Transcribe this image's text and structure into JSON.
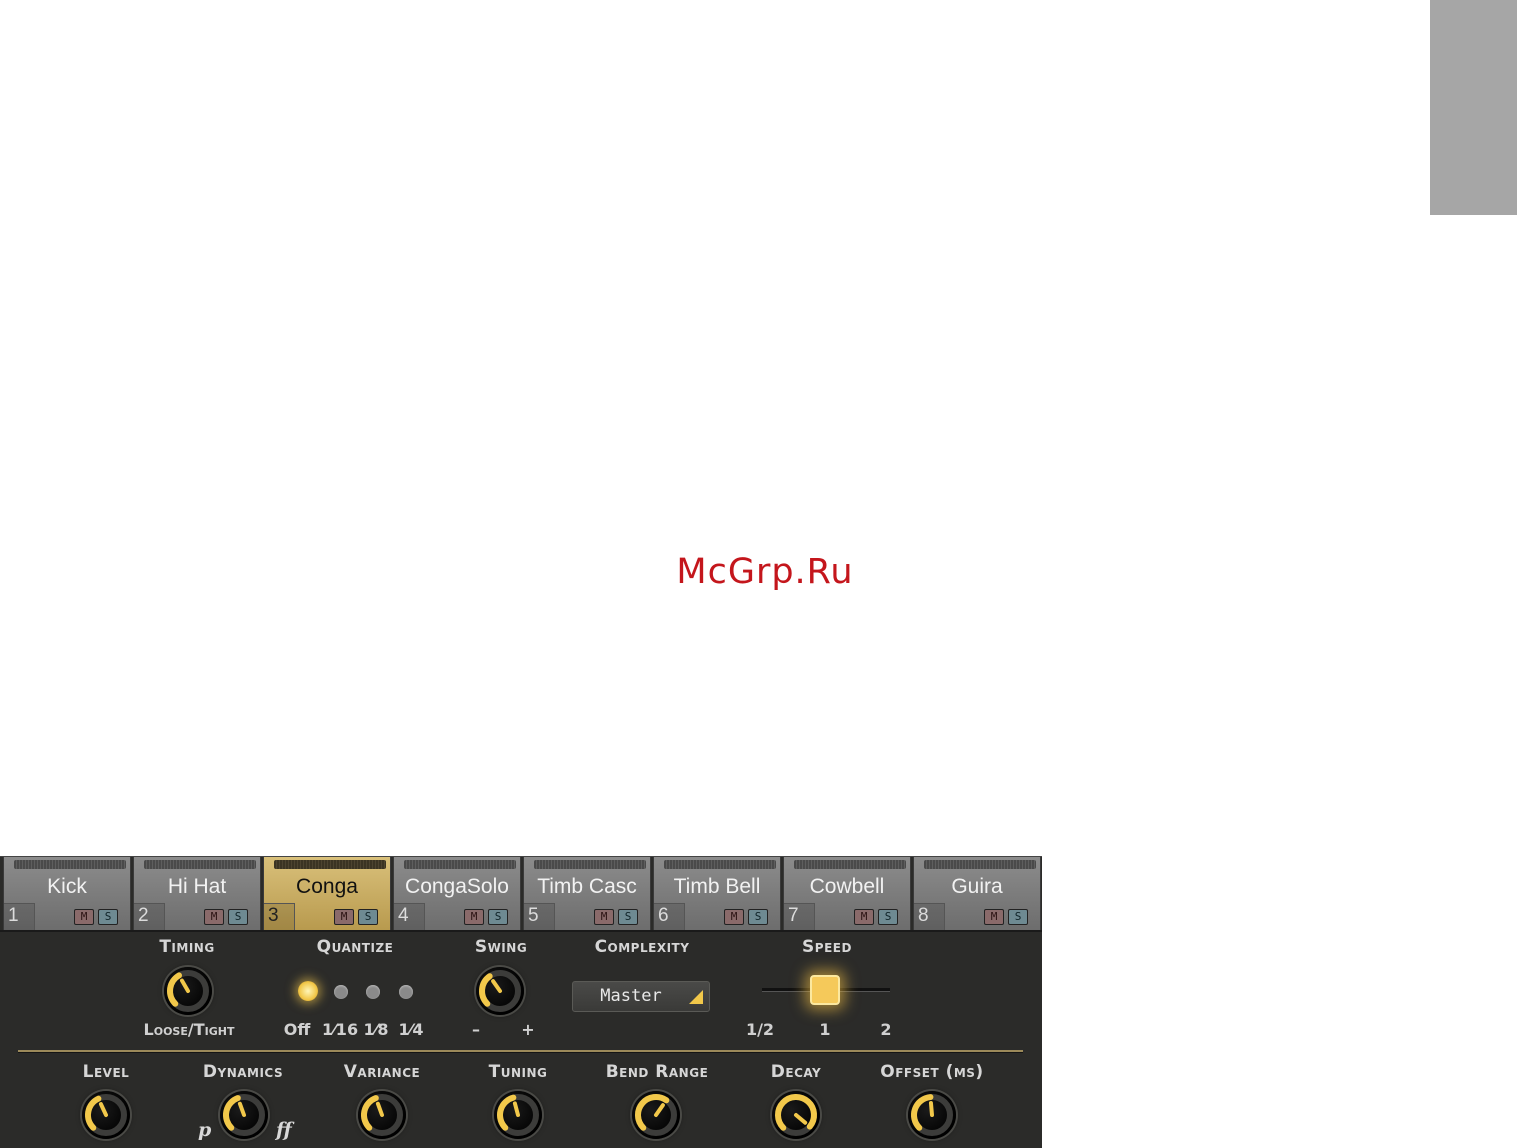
{
  "watermark": "McGrp.Ru",
  "tabs": [
    {
      "name": "Kick",
      "number": "1",
      "active": false
    },
    {
      "name": "Hi Hat",
      "number": "2",
      "active": false
    },
    {
      "name": "Conga",
      "number": "3",
      "active": true
    },
    {
      "name": "CongaSolo",
      "number": "4",
      "active": false
    },
    {
      "name": "Timb Casc",
      "number": "5",
      "active": false
    },
    {
      "name": "Timb Bell",
      "number": "6",
      "active": false
    },
    {
      "name": "Cowbell",
      "number": "7",
      "active": false
    },
    {
      "name": "Guira",
      "number": "8",
      "active": false
    }
  ],
  "mute_label": "M",
  "solo_label": "S",
  "timing": {
    "label": "Timing",
    "sublabel": "Loose/Tight"
  },
  "quantize": {
    "label": "Quantize",
    "options": [
      "Off",
      "1⁄16",
      "1⁄8",
      "1⁄4"
    ],
    "selected": "Off"
  },
  "swing": {
    "label": "Swing",
    "minus": "–",
    "plus": "+"
  },
  "complexity": {
    "label": "Complexity",
    "value": "Master"
  },
  "speed": {
    "label": "Speed",
    "ticks": [
      "1/2",
      "1",
      "2"
    ],
    "selected": "1"
  },
  "knobs": [
    {
      "label": "Level"
    },
    {
      "label": "Dynamics",
      "min_mark": "p",
      "max_mark": "ff"
    },
    {
      "label": "Variance"
    },
    {
      "label": "Tuning"
    },
    {
      "label": "Bend Range"
    },
    {
      "label": "Decay"
    },
    {
      "label": "Offset (ms)"
    }
  ],
  "colors": {
    "accent": "#f2c84a",
    "panel": "#2b2b29",
    "active_tab": "#c9ad63"
  }
}
